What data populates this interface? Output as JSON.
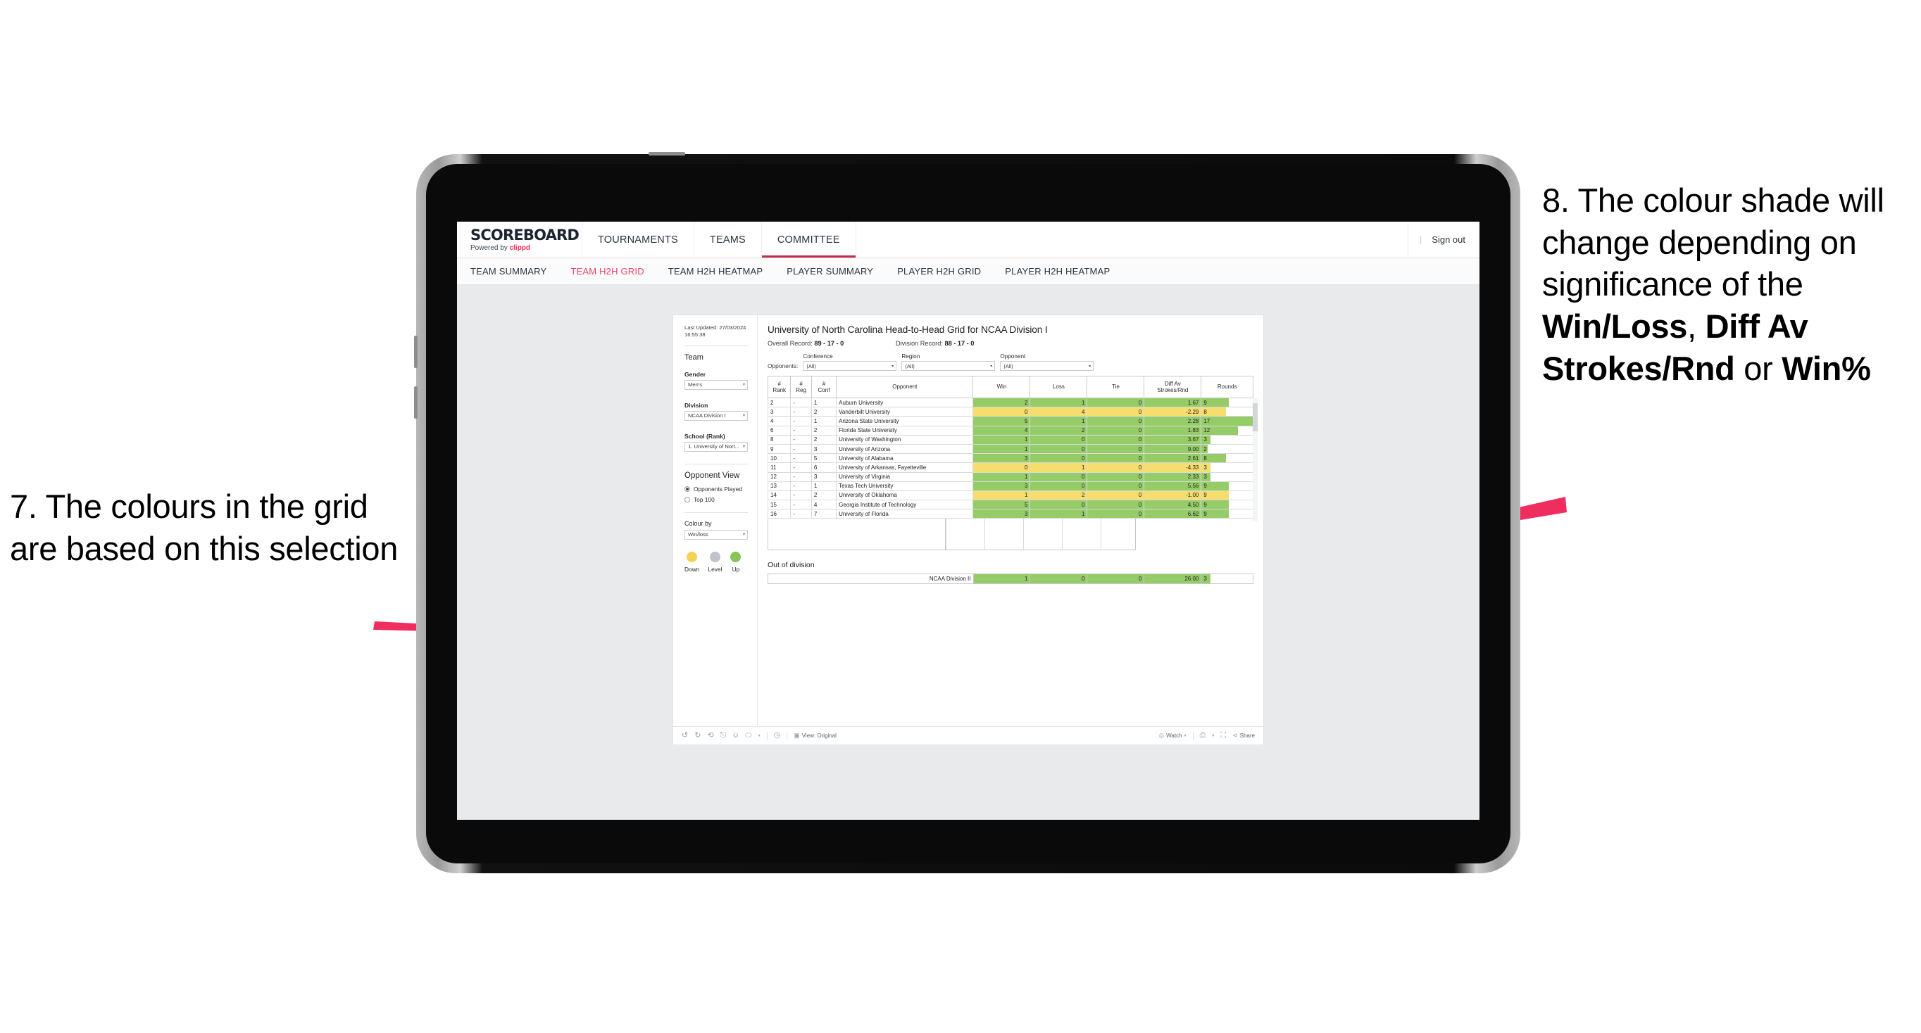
{
  "annotations": {
    "left": {
      "text": "7. The colours in the grid are based on this selection"
    },
    "right": {
      "part1": "8. The colour shade will change depending on significance of the ",
      "bold1": "Win/Loss",
      "mid1": ", ",
      "bold2": "Diff Av Strokes/Rnd",
      "mid2": " or ",
      "bold3": "Win%"
    },
    "arrow_color": "#ef2d5e"
  },
  "topnav": {
    "brand_name": "SCOREBOARD",
    "brand_sub_prefix": "Powered by ",
    "brand_sub_accent": "clippd",
    "tabs": [
      {
        "label": "TOURNAMENTS",
        "active": false
      },
      {
        "label": "TEAMS",
        "active": false
      },
      {
        "label": "COMMITTEE",
        "active": true
      }
    ],
    "divider": "|",
    "signout": "Sign out",
    "accent": "#c42a4d"
  },
  "subnav": {
    "tabs": [
      {
        "label": "TEAM SUMMARY",
        "active": false
      },
      {
        "label": "TEAM H2H GRID",
        "active": true
      },
      {
        "label": "TEAM H2H HEATMAP",
        "active": false
      },
      {
        "label": "PLAYER SUMMARY",
        "active": false
      },
      {
        "label": "PLAYER H2H GRID",
        "active": false
      },
      {
        "label": "PLAYER H2H HEATMAP",
        "active": false
      }
    ],
    "active_color": "#ef4068"
  },
  "sidebar": {
    "last_updated": "Last Updated: 27/03/2024 16:55:38",
    "team_heading": "Team",
    "gender_label": "Gender",
    "gender_value": "Men's",
    "division_label": "Division",
    "division_value": "NCAA Division I",
    "school_label": "School (Rank)",
    "school_value": "1. University of Nort...",
    "opponent_view_heading": "Opponent View",
    "opponent_options": [
      {
        "label": "Opponents Played",
        "selected": true
      },
      {
        "label": "Top 100",
        "selected": false
      }
    ],
    "colour_by_label": "Colour by",
    "colour_by_value": "Win/loss",
    "legend": [
      {
        "label": "Down",
        "color": "#f4d155"
      },
      {
        "label": "Level",
        "color": "#c0c4c8"
      },
      {
        "label": "Up",
        "color": "#86c556"
      }
    ]
  },
  "main": {
    "title": "University of North Carolina Head-to-Head Grid for NCAA Division I",
    "overall_record_label": "Overall Record: ",
    "overall_record_value": "89 - 17 - 0",
    "division_record_label": "Division Record: ",
    "division_record_value": "88 - 17 - 0",
    "opponents_label": "Opponents:",
    "filters": [
      {
        "title": "Conference",
        "value": "(All)"
      },
      {
        "title": "Region",
        "value": "(All)"
      },
      {
        "title": "Opponent",
        "value": "(All)"
      }
    ],
    "columns": [
      {
        "line1": "#",
        "line2": "Rank"
      },
      {
        "line1": "#",
        "line2": "Reg"
      },
      {
        "line1": "#",
        "line2": "Conf"
      },
      {
        "line1": "",
        "line2": "Opponent"
      },
      {
        "line1": "",
        "line2": "Win"
      },
      {
        "line1": "",
        "line2": "Loss"
      },
      {
        "line1": "",
        "line2": "Tie"
      },
      {
        "line1": "Diff Av",
        "line2": "Strokes/Rnd"
      },
      {
        "line1": "",
        "line2": "Rounds"
      }
    ],
    "out_of_division_title": "Out of division"
  },
  "chart_data": {
    "type": "table",
    "title": "University of North Carolina Head-to-Head Grid for NCAA Division I",
    "colour_by": "Win/loss",
    "colors": {
      "up": "#96cc68",
      "down": "#f5dd6e",
      "level": "#c0c4c8"
    },
    "rounds_max": 17,
    "columns": [
      "# Rank",
      "# Reg",
      "# Conf",
      "Opponent",
      "Win",
      "Loss",
      "Tie",
      "Diff Av Strokes/Rnd",
      "Rounds"
    ],
    "rows": [
      {
        "rank": "2",
        "reg": "-",
        "conf": "1",
        "opponent": "Auburn University",
        "win": "2",
        "loss": "1",
        "tie": "0",
        "diff": "1.67",
        "rounds": "9",
        "state": "up"
      },
      {
        "rank": "3",
        "reg": "-",
        "conf": "2",
        "opponent": "Vanderbilt University",
        "win": "0",
        "loss": "4",
        "tie": "0",
        "diff": "-2.29",
        "rounds": "8",
        "state": "down"
      },
      {
        "rank": "4",
        "reg": "-",
        "conf": "1",
        "opponent": "Arizona State University",
        "win": "5",
        "loss": "1",
        "tie": "0",
        "diff": "2.28",
        "rounds": "17",
        "state": "up"
      },
      {
        "rank": "6",
        "reg": "-",
        "conf": "2",
        "opponent": "Florida State University",
        "win": "4",
        "loss": "2",
        "tie": "0",
        "diff": "1.83",
        "rounds": "12",
        "state": "up"
      },
      {
        "rank": "8",
        "reg": "-",
        "conf": "2",
        "opponent": "University of Washington",
        "win": "1",
        "loss": "0",
        "tie": "0",
        "diff": "3.67",
        "rounds": "3",
        "state": "up"
      },
      {
        "rank": "9",
        "reg": "-",
        "conf": "3",
        "opponent": "University of Arizona",
        "win": "1",
        "loss": "0",
        "tie": "0",
        "diff": "9.00",
        "rounds": "2",
        "state": "up"
      },
      {
        "rank": "10",
        "reg": "-",
        "conf": "5",
        "opponent": "University of Alabama",
        "win": "3",
        "loss": "0",
        "tie": "0",
        "diff": "2.61",
        "rounds": "8",
        "state": "up"
      },
      {
        "rank": "11",
        "reg": "-",
        "conf": "6",
        "opponent": "University of Arkansas, Fayetteville",
        "win": "0",
        "loss": "1",
        "tie": "0",
        "diff": "-4.33",
        "rounds": "3",
        "state": "down"
      },
      {
        "rank": "12",
        "reg": "-",
        "conf": "3",
        "opponent": "University of Virginia",
        "win": "1",
        "loss": "0",
        "tie": "0",
        "diff": "2.33",
        "rounds": "3",
        "state": "up"
      },
      {
        "rank": "13",
        "reg": "-",
        "conf": "1",
        "opponent": "Texas Tech University",
        "win": "3",
        "loss": "0",
        "tie": "0",
        "diff": "5.56",
        "rounds": "9",
        "state": "up"
      },
      {
        "rank": "14",
        "reg": "-",
        "conf": "2",
        "opponent": "University of Oklahoma",
        "win": "1",
        "loss": "2",
        "tie": "0",
        "diff": "-1.00",
        "rounds": "9",
        "state": "down"
      },
      {
        "rank": "15",
        "reg": "-",
        "conf": "4",
        "opponent": "Georgia Institute of Technology",
        "win": "5",
        "loss": "0",
        "tie": "0",
        "diff": "4.50",
        "rounds": "9",
        "state": "up"
      },
      {
        "rank": "16",
        "reg": "-",
        "conf": "7",
        "opponent": "University of Florida",
        "win": "3",
        "loss": "1",
        "tie": "0",
        "diff": "6.62",
        "rounds": "9",
        "state": "up"
      }
    ],
    "out_of_division": [
      {
        "opponent": "NCAA Division II",
        "win": "1",
        "loss": "0",
        "tie": "0",
        "diff": "26.00",
        "rounds": "3",
        "state": "up"
      }
    ]
  },
  "toolbar": {
    "view_label": "View: Original",
    "watch_label": "Watch",
    "share_label": "Share",
    "icons": [
      "undo-icon",
      "redo-icon",
      "revert-icon",
      "refresh-icon",
      "pause-icon",
      "pan-icon",
      "chevron-down-icon",
      "speedometer-icon"
    ]
  }
}
